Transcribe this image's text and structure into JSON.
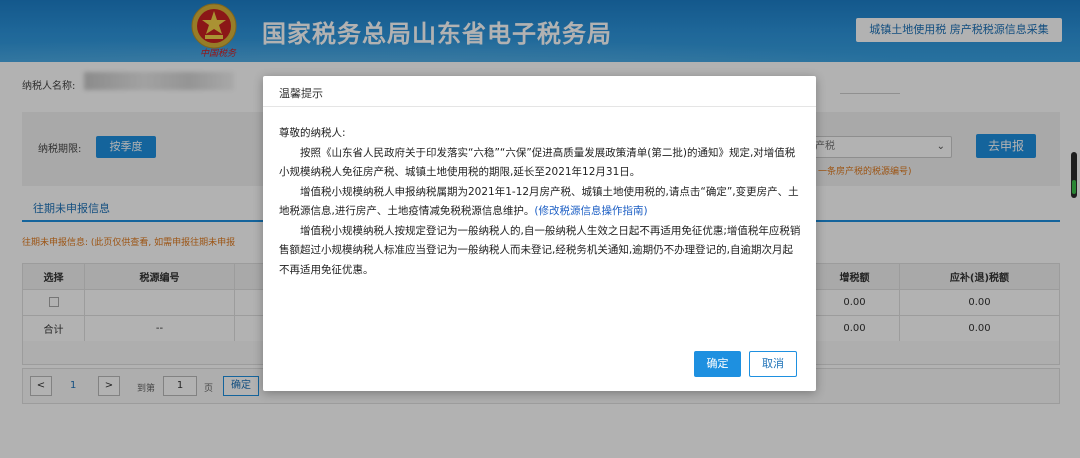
{
  "header": {
    "title": "国家税务总局山东省电子税务局",
    "emblem_sign": "中国税务",
    "right_link": "城镇土地使用税 房产税税源信息采集"
  },
  "taxpayer": {
    "label": "纳税人名称:"
  },
  "filter": {
    "period_label": "纳税期限:",
    "quarter_button": "按季度",
    "tax_type_value": "产税",
    "declare_button": "去申报",
    "note": "一条房产税的税源编号)"
  },
  "tab": {
    "label": "往期未申报信息"
  },
  "info_note": "往期未申报信息: (此页仅供查看, 如需申报往期未申报",
  "table": {
    "headers": [
      "选择",
      "税源编号",
      "",
      "",
      "",
      "",
      "",
      "",
      "",
      "增税额",
      "应补(退)税额"
    ],
    "rows": [
      {
        "select": "",
        "source_id": "",
        "tax": "0.00",
        "due": "0.00"
      },
      {
        "select": "合计",
        "source_id": "--",
        "tax": "0.00",
        "due": "0.00"
      }
    ]
  },
  "pager": {
    "prev": "<",
    "current_page": "1",
    "next": ">",
    "goto_label": "到第",
    "goto_value": "1",
    "page_unit": "页",
    "confirm": "确定"
  },
  "modal": {
    "title": "温馨提示",
    "salutation": "尊敬的纳税人:",
    "para1": "按照《山东省人民政府关于印发落实“六稳”“六保”促进高质量发展政策清单(第二批)的通知》规定,对增值税小规模纳税人免征房产税、城镇土地使用税的期限,延长至2021年12月31日。",
    "para2_text": "增值税小规模纳税人申报纳税属期为2021年1-12月房产税、城镇土地使用税的,请点击“确定”,变更房产、土地税源信息,进行房产、土地疫情减免税税源信息维护。",
    "para2_link": "(修改税源信息操作指南)",
    "para3": "增值税小规模纳税人按规定登记为一般纳税人的,自一般纳税人生效之日起不再适用免征优惠;增值税年应税销售额超过小规模纳税人标准应当登记为一般纳税人而未登记,经税务机关通知,逾期仍不办理登记的,自逾期次月起不再适用免征优惠。",
    "ok_button": "确定",
    "cancel_button": "取消"
  }
}
